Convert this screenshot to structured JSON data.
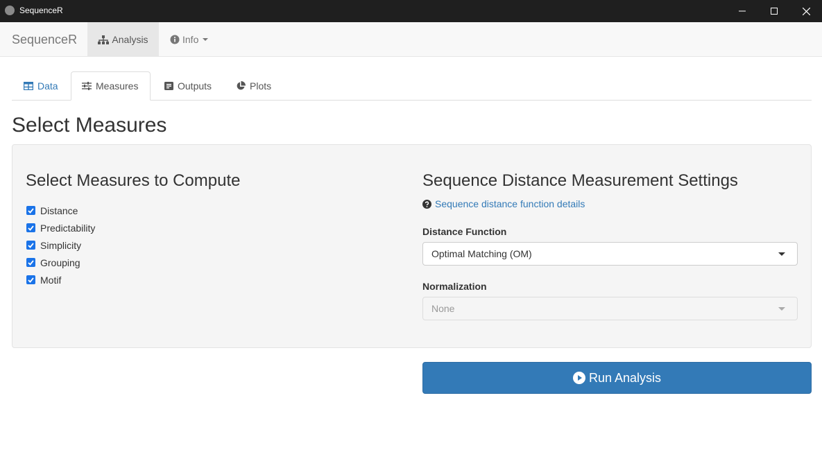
{
  "window": {
    "title": "SequenceR",
    "controls": [
      "minimize-icon",
      "maximize-icon",
      "close-icon"
    ]
  },
  "navbar": {
    "brand": "SequenceR",
    "items": [
      {
        "label": "Analysis",
        "icon": "sitemap-icon",
        "active": true
      },
      {
        "label": "Info",
        "icon": "info-circle-icon",
        "dropdown": true
      }
    ]
  },
  "tabs": [
    {
      "label": "Data",
      "icon": "table-icon",
      "active": false
    },
    {
      "label": "Measures",
      "icon": "sliders-icon",
      "active": true
    },
    {
      "label": "Outputs",
      "icon": "list-alt-icon",
      "active": false
    },
    {
      "label": "Plots",
      "icon": "pie-chart-icon",
      "active": false
    }
  ],
  "page": {
    "title": "Select Measures"
  },
  "measures": {
    "title": "Select Measures to Compute",
    "options": [
      {
        "label": "Distance",
        "checked": true
      },
      {
        "label": "Predictability",
        "checked": true
      },
      {
        "label": "Simplicity",
        "checked": true
      },
      {
        "label": "Grouping",
        "checked": true
      },
      {
        "label": "Motif",
        "checked": true
      }
    ]
  },
  "settings": {
    "title": "Sequence Distance Measurement Settings",
    "help_link": "Sequence distance function details",
    "distance_label": "Distance Function",
    "distance_value": "Optimal Matching (OM)",
    "normalization_label": "Normalization",
    "normalization_value": "None",
    "normalization_disabled": true
  },
  "run_button": {
    "label": "Run Analysis",
    "icon": "play-circle-icon"
  },
  "colors": {
    "titlebar": "#1f1f1f",
    "navbar": "#f8f8f8",
    "primary": "#337ab7",
    "link": "#337ab7",
    "checkbox": "#1a73e8",
    "well": "#f5f5f5"
  }
}
